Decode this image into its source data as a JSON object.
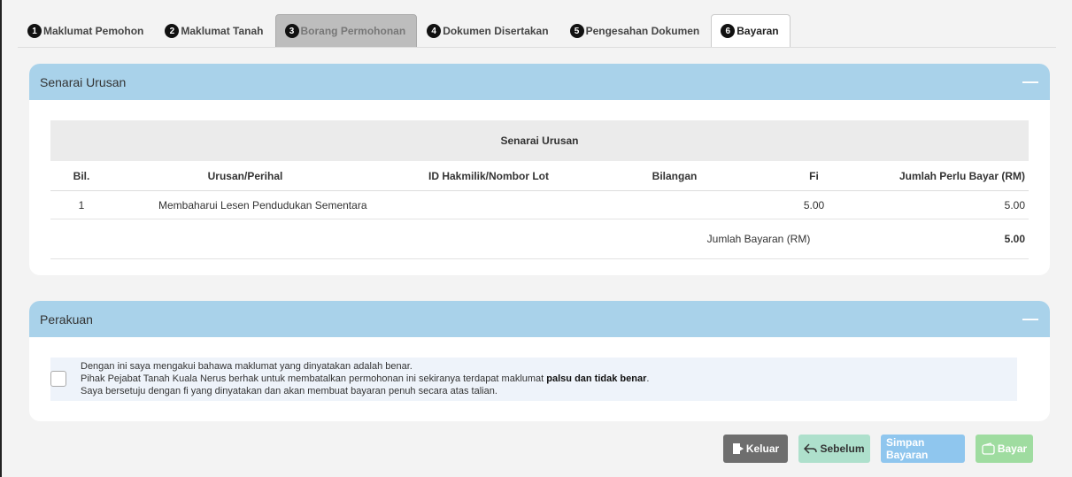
{
  "tabs": [
    {
      "num": "1",
      "label": "Maklumat Pemohon",
      "state": "normal"
    },
    {
      "num": "2",
      "label": "Maklumat Tanah",
      "state": "normal"
    },
    {
      "num": "3",
      "label": "Borang Permohonan",
      "state": "disabled"
    },
    {
      "num": "4",
      "label": "Dokumen Disertakan",
      "state": "normal"
    },
    {
      "num": "5",
      "label": "Pengesahan Dokumen",
      "state": "normal"
    },
    {
      "num": "6",
      "label": "Bayaran",
      "state": "active"
    }
  ],
  "urusan": {
    "header": "Senarai Urusan",
    "collapse": "—",
    "table_title": "Senarai Urusan",
    "columns": [
      "Bil.",
      "Urusan/Perihal",
      "ID Hakmilik/Nombor Lot",
      "Bilangan",
      "Fi",
      "Jumlah Perlu Bayar (RM)"
    ],
    "rows": [
      {
        "bil": "1",
        "perihal": "Membaharui Lesen Pendudukan Sementara",
        "hakmilik": "",
        "bilangan": "",
        "fi": "5.00",
        "jumlah": "5.00"
      }
    ],
    "total_label": "Jumlah Bayaran (RM)",
    "total_value": "5.00"
  },
  "perakuan": {
    "header": "Perakuan",
    "collapse": "—",
    "line1": "Dengan ini saya mengakui bahawa maklumat yang dinyatakan adalah benar.",
    "line2_pre": "Pihak Pejabat Tanah Kuala Nerus berhak untuk membatalkan permohonan ini sekiranya terdapat maklumat ",
    "line2_bold": "palsu dan tidak benar",
    "line2_post": ".",
    "line3": "Saya bersetuju dengan fi yang dinyatakan dan akan membuat bayaran penuh secara atas talian.",
    "checked": false
  },
  "buttons": {
    "keluar": "Keluar",
    "sebelum": "Sebelum",
    "simpan": "Simpan Bayaran",
    "bayar": "Bayar"
  },
  "colors": {
    "header_bg": "#a9d2ea",
    "keluar": "#6e6e6e",
    "sebelum": "#aee0cc",
    "simpan": "#8fc6ee",
    "bayar": "#9fdca0"
  },
  "icons": {
    "keluar": "exit-door-icon",
    "sebelum": "reply-arrow-icon",
    "bayar": "wallet-icon"
  }
}
